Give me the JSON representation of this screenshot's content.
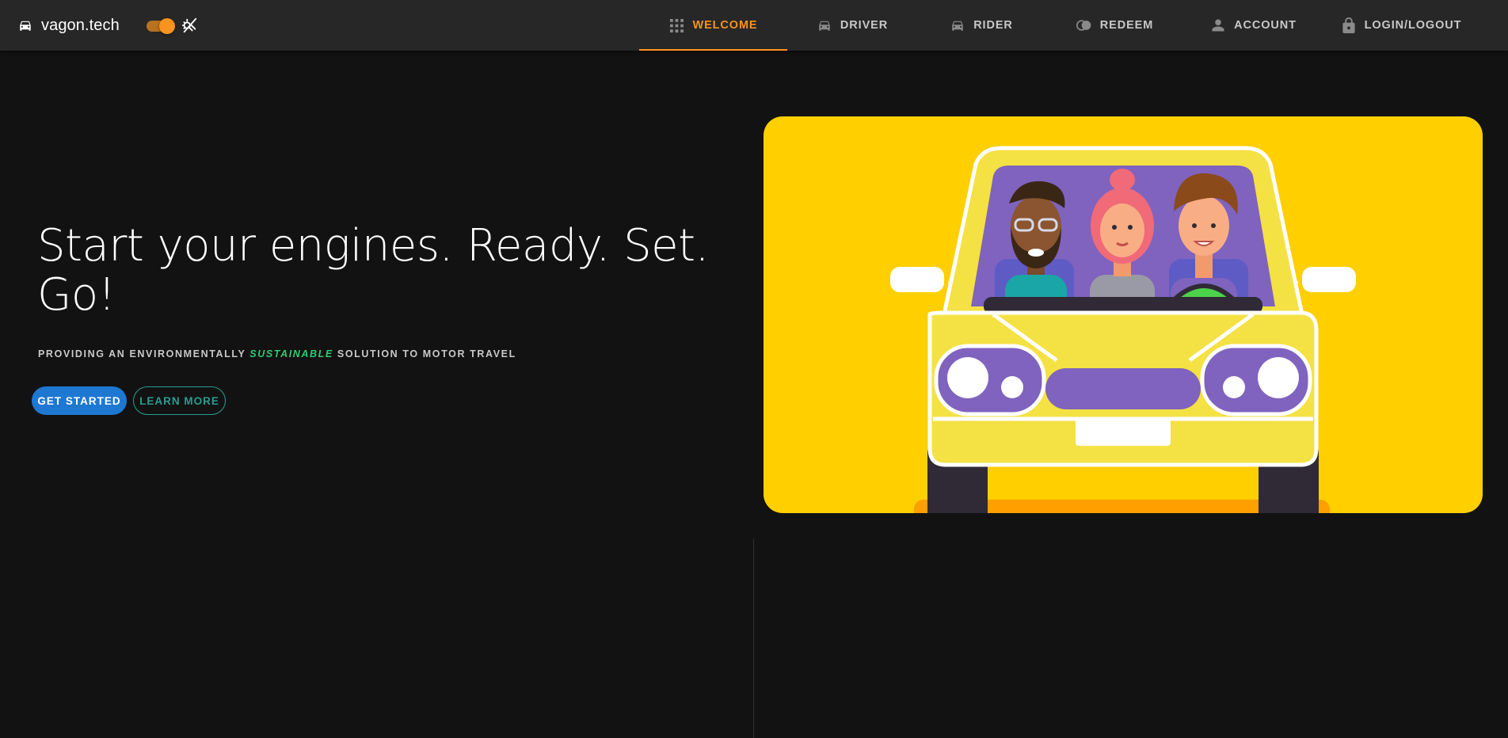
{
  "brand": {
    "name": "vagon.tech",
    "icon": "car-icon",
    "theme_icon": "theme-auto-icon"
  },
  "theme_toggle": {
    "checked": true,
    "color": "#f7931e"
  },
  "nav": {
    "tabs": [
      {
        "label": "Welcome",
        "icon": "grid-icon",
        "active": true
      },
      {
        "label": "Driver",
        "icon": "car-icon",
        "active": false
      },
      {
        "label": "Rider",
        "icon": "car-icon",
        "active": false
      },
      {
        "label": "Redeem",
        "icon": "toggle-coin-icon",
        "active": false
      },
      {
        "label": "Account",
        "icon": "person-icon",
        "active": false
      },
      {
        "label": "Login/Logout",
        "icon": "lock-icon",
        "active": false
      }
    ]
  },
  "hero": {
    "title": "Start your engines. Ready. Set. Go!",
    "subtitle_before": "Providing an environmentally",
    "subtitle_accent": "sustainable",
    "subtitle_after": "solution to motor travel",
    "primary_button": "Get Started",
    "secondary_button": "Learn More",
    "image": "car-illustration-three-friends"
  },
  "colors": {
    "accent": "#f7931e",
    "primary_button": "#1e78d2",
    "outline_button": "#2a9d8f",
    "sustainable": "#2ecc71",
    "image_background": "#ffcf00",
    "page_background": "#121212",
    "appbar_background": "#272727"
  }
}
